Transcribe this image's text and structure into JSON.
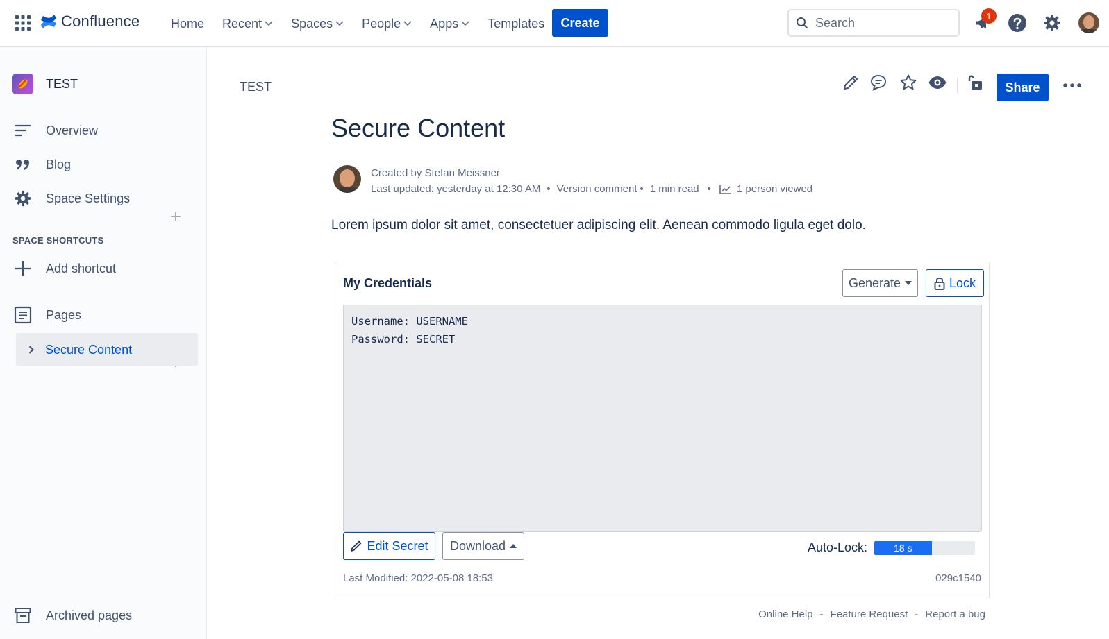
{
  "nav": {
    "brand": "Confluence",
    "items": [
      {
        "label": "Home",
        "dropdown": false
      },
      {
        "label": "Recent",
        "dropdown": true
      },
      {
        "label": "Spaces",
        "dropdown": true
      },
      {
        "label": "People",
        "dropdown": true
      },
      {
        "label": "Apps",
        "dropdown": true
      },
      {
        "label": "Templates",
        "dropdown": false
      }
    ],
    "create_label": "Create",
    "search_placeholder": "Search",
    "notification_count": "1"
  },
  "sidebar": {
    "space_name": "TEST",
    "items": {
      "overview": "Overview",
      "blog": "Blog",
      "space_settings": "Space Settings"
    },
    "shortcuts_title": "SPACE SHORTCUTS",
    "add_shortcut": "Add shortcut",
    "pages": "Pages",
    "tree_item": "Secure Content",
    "archived": "Archived pages"
  },
  "page": {
    "breadcrumb": "TEST",
    "share_label": "Share",
    "title": "Secure Content",
    "created_by": "Created by Stefan Meissner",
    "last_updated": "Last updated: yesterday at 12:30 AM",
    "version_comment": "Version comment",
    "read_time": "1 min read",
    "viewed": "1 person viewed",
    "body": "Lorem ipsum dolor sit amet, consectetuer adipiscing elit. Aenean commodo ligula eget dolo."
  },
  "credentials": {
    "title": "My Credentials",
    "generate_label": "Generate",
    "lock_label": "Lock",
    "secret_text": "Username: USERNAME\nPassword: SECRET",
    "edit_label": "Edit Secret",
    "download_label": "Download",
    "autolock_label": "Auto-Lock:",
    "autolock_value": "18 s",
    "autolock_fraction": 0.57,
    "last_modified": "Last Modified: 2022-05-08 18:53",
    "hash": "029c1540"
  },
  "footer": {
    "help": "Online Help",
    "feature": "Feature Request",
    "bug": "Report a bug",
    "separator": "-"
  },
  "colors": {
    "primary": "#0052cc",
    "badge": "#de350b",
    "progress": "#1b6ef3"
  }
}
